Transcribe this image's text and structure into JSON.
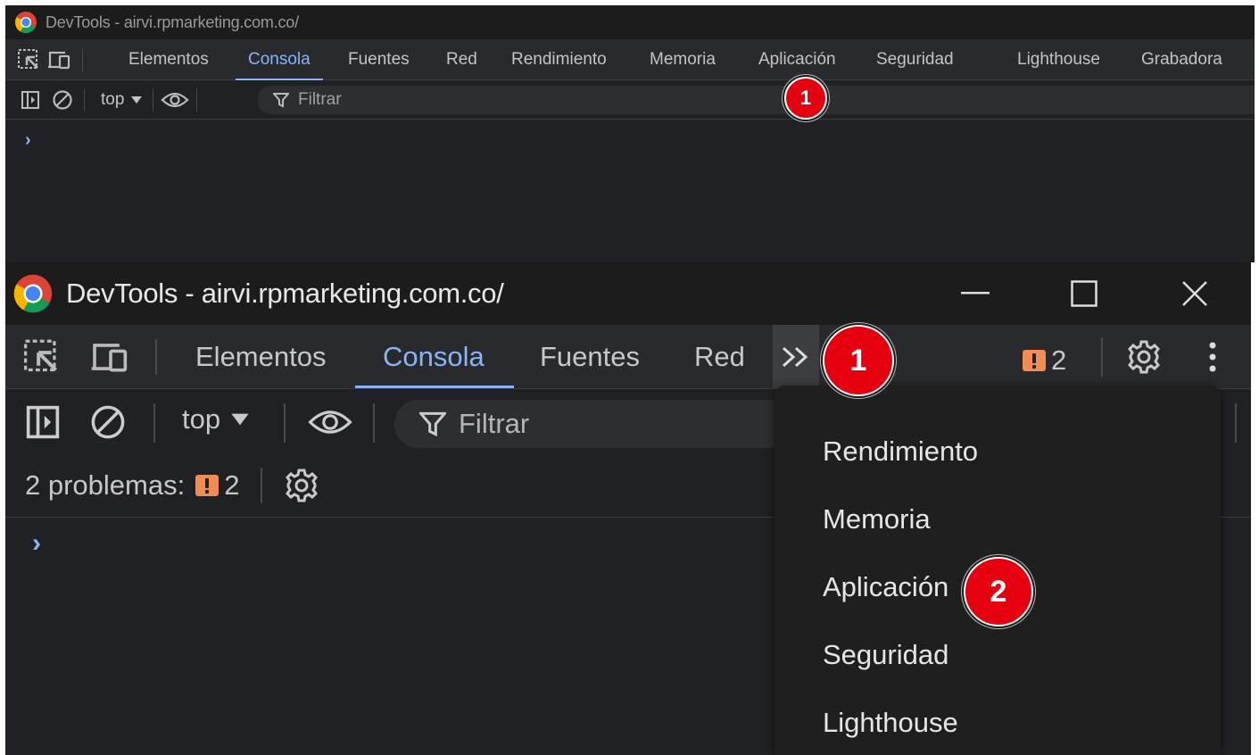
{
  "small_window": {
    "title": "DevTools - airvi.rpmarketing.com.co/",
    "tabs": [
      "Elementos",
      "Consola",
      "Fuentes",
      "Red",
      "Rendimiento",
      "Memoria",
      "Aplicación",
      "Seguridad",
      "Lighthouse",
      "Grabadora"
    ],
    "active_tab": "Consola",
    "context": "top",
    "filter_placeholder": "Filtrar",
    "marker": "1"
  },
  "large_window": {
    "title": "DevTools - airvi.rpmarketing.com.co/",
    "tabs": [
      "Elementos",
      "Consola",
      "Fuentes",
      "Red"
    ],
    "active_tab": "Consola",
    "more_tabs_label": "»",
    "issues_count": "2",
    "context": "top",
    "filter_placeholder": "Filtrar",
    "problems_label": "2 problemas:",
    "problems_count": "2",
    "marker": "1"
  },
  "overflow_menu": {
    "items": [
      "Rendimiento",
      "Memoria",
      "Aplicación",
      "Seguridad",
      "Lighthouse"
    ],
    "marker": "2"
  },
  "colors": {
    "accent": "#8ab4f8",
    "warning": "#f28b54",
    "marker_red": "#e4000f",
    "background": "#202124"
  }
}
